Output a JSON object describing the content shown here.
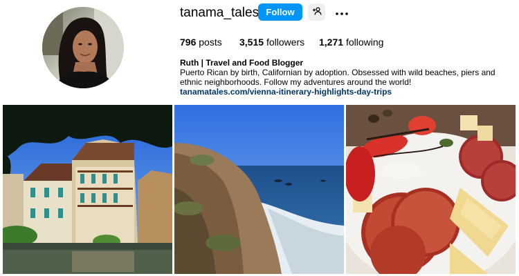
{
  "profile": {
    "username": "tanama_tales",
    "follow_label": "Follow",
    "suggest_icon": "add-person-icon",
    "more_icon": "more-options-icon"
  },
  "stats": {
    "posts_count": "796",
    "posts_label": "posts",
    "followers_count": "3,515",
    "followers_label": "followers",
    "following_count": "1,271",
    "following_label": "following"
  },
  "bio": {
    "name": "Ruth | Travel and Food Blogger",
    "text": "Puerto Rican by birth, Californian by adoption. Obsessed with wild beaches, piers and ethnic neighborhoods. Follow my adventures around the world!",
    "link": "tanamatales.com/vienna-itinerary-highlights-day-trips"
  },
  "colors": {
    "follow_button": "#0095f6",
    "link": "#00376b",
    "secondary_button": "#efefef"
  }
}
